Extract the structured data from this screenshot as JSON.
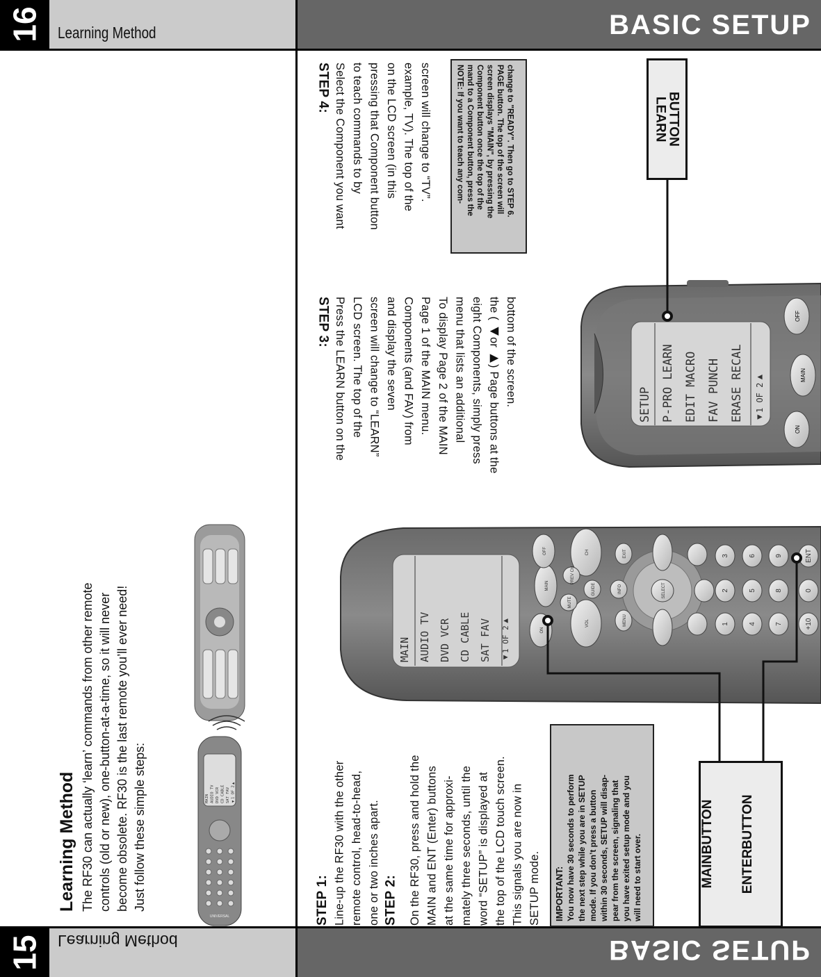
{
  "page16": {
    "page_number": "16",
    "section": "Learning Method",
    "chapter": "BASIC SETUP",
    "step3": {
      "heading": "STEP 3:",
      "lines": [
        "Press the LEARN button on the",
        "LCD screen. The top of the",
        "screen will change to “LEARN”",
        "and display the seven",
        "Components (and FAV) from",
        "Page 1 of the MAIN menu.",
        "",
        "To display Page 2 of the MAIN",
        "menu that lists an additional",
        "eight Components, simply press",
        "the ( ◀or ▶) Page buttons at the",
        "bottom of the screen."
      ]
    },
    "step4": {
      "heading": "STEP 4:",
      "lines": [
        "Select the Component you want",
        "to teach commands to by",
        "pressing that Component button",
        "on the LCD screen (in this",
        "example, TV). The top of the",
        "screen will change to  “TV”."
      ]
    },
    "note": [
      "NOTE: If you want to teach any com-",
      "mand to a Component button, press the",
      "Component button once the top of the",
      "screen displays \"MAIN\", by pressing the",
      "PAGE button. The top of the screen will",
      "change to \"READY\". Then go to STEP 6."
    ],
    "callout_learn": [
      "LEARN",
      "BUTTON"
    ],
    "remote_lcd": [
      "SETUP",
      "P-PRO LEARN",
      "EDIT  MACRO",
      "FAV   PUNCH",
      "ERASE RECAL",
      "◀1 OF 2▶"
    ],
    "remote_buttons": {
      "off": "OFF",
      "main": "MAIN",
      "on": "ON"
    }
  },
  "page15": {
    "page_number": "15",
    "section": "Learning Method",
    "chapter": "BASIC SETUP",
    "intro": {
      "heading": "Learning Method",
      "lines": [
        "The RF30 can actually ‘learn’ commands from other remote",
        "controls (old or new), one-button-at-a-time, so it will never",
        "become obsolete. RF30 is the last remote you’ll ever need!",
        "Just follow these simple steps:"
      ]
    },
    "step1": {
      "heading": "STEP 1:",
      "lines": [
        "Line-up the RF30 with the other",
        "remote control, head-to-head,",
        "one or two inches apart."
      ]
    },
    "step2": {
      "heading": "STEP 2:",
      "lines": [
        "On the RF30, press and hold the",
        "MAIN and ENT (Enter) buttons",
        "at the same time for approxi-",
        "mately three seconds, until the",
        "word “SETUP” is displayed at",
        "the top of the LCD touch screen.",
        "This signals you are now in",
        "SETUP mode."
      ]
    },
    "important": [
      "IMPORTANT:",
      "You now have 30 seconds to perform",
      "the next step while you are in SETUP",
      "mode. If you don’t press a button",
      "within 30 seconds, SETUP will disap-",
      "pear from the screen, signaling that",
      "you have exited setup mode and you",
      "will need to start over."
    ],
    "callout_main": [
      "MAIN",
      "BUTTON"
    ],
    "callout_enter": [
      "ENTER",
      "BUTTON"
    ],
    "remote_lcd": [
      "MAIN",
      "AUDIO   TV",
      "DVD    VCR",
      "CD   CABLE",
      "SAT    FAV",
      "◀1 OF 2▶"
    ],
    "remote_buttons": {
      "on": "ON",
      "main": "MAIN",
      "off": "OFF",
      "vol": "VOL",
      "ch": "CH",
      "mute": "MUTE",
      "prev": "PREV CH",
      "guide": "GUIDE",
      "menu": "MENU",
      "info": "INFO",
      "exit": "EXIT",
      "select": "SELECT",
      "n1": "1",
      "n2": "2",
      "n3": "3",
      "n4": "4",
      "n5": "5",
      "n6": "6",
      "n7": "7",
      "n8": "8",
      "n9": "9",
      "n0": "0",
      "plus10": "+10",
      "ent": "ENT"
    },
    "small_remote_brand": "UNIVERSAL"
  },
  "colors": {
    "header_gray": "#cbcbcb",
    "header_dark": "#666666",
    "note_gray": "#c8c8c8",
    "page_box": "#000000"
  }
}
